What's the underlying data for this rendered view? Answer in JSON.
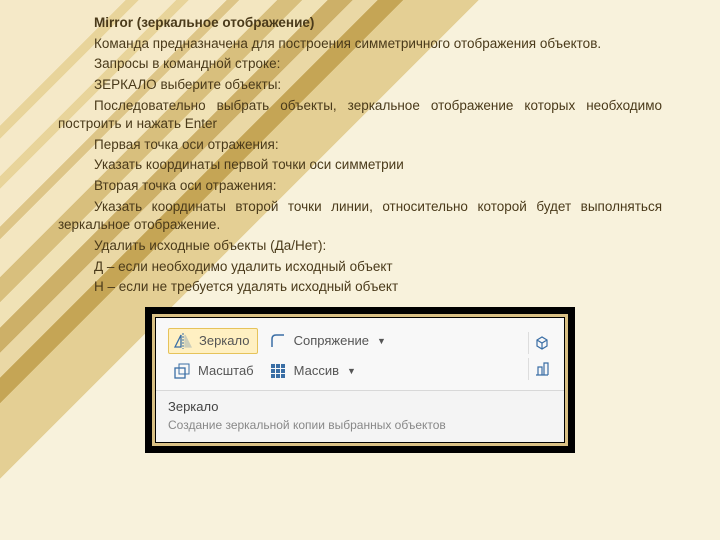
{
  "doc": {
    "p1_bold": "Mirror (зеркальное отображение)",
    "p2": "Команда предназначена для построения симметричного отображения объектов.",
    "p3": "Запросы в командной строке:",
    "p4": "ЗЕРКАЛО выберите объекты:",
    "p5": "Последовательно выбрать объекты, зеркальное отображение которых необходимо построить и нажать Enter",
    "p6": "Первая точка оси отражения:",
    "p7": "Указать координаты первой точки оси симметрии",
    "p8": "Вторая точка оси отражения:",
    "p9": "Указать координаты второй точки линии, относительно которой будет выполняться зеркальное отображение.",
    "p10": "Удалить исходные объекты (Да/Нет):",
    "p11": "Д – если необходимо удалить исходный объект",
    "p12": "Н – если не требуется удалять исходный объект"
  },
  "ribbon": {
    "mirror": "Зеркало",
    "scale": "Масштаб",
    "fillet": "Сопряжение",
    "array": "Массив"
  },
  "tooltip": {
    "title": "Зеркало",
    "desc": "Создание зеркальной копии выбранных объектов"
  }
}
